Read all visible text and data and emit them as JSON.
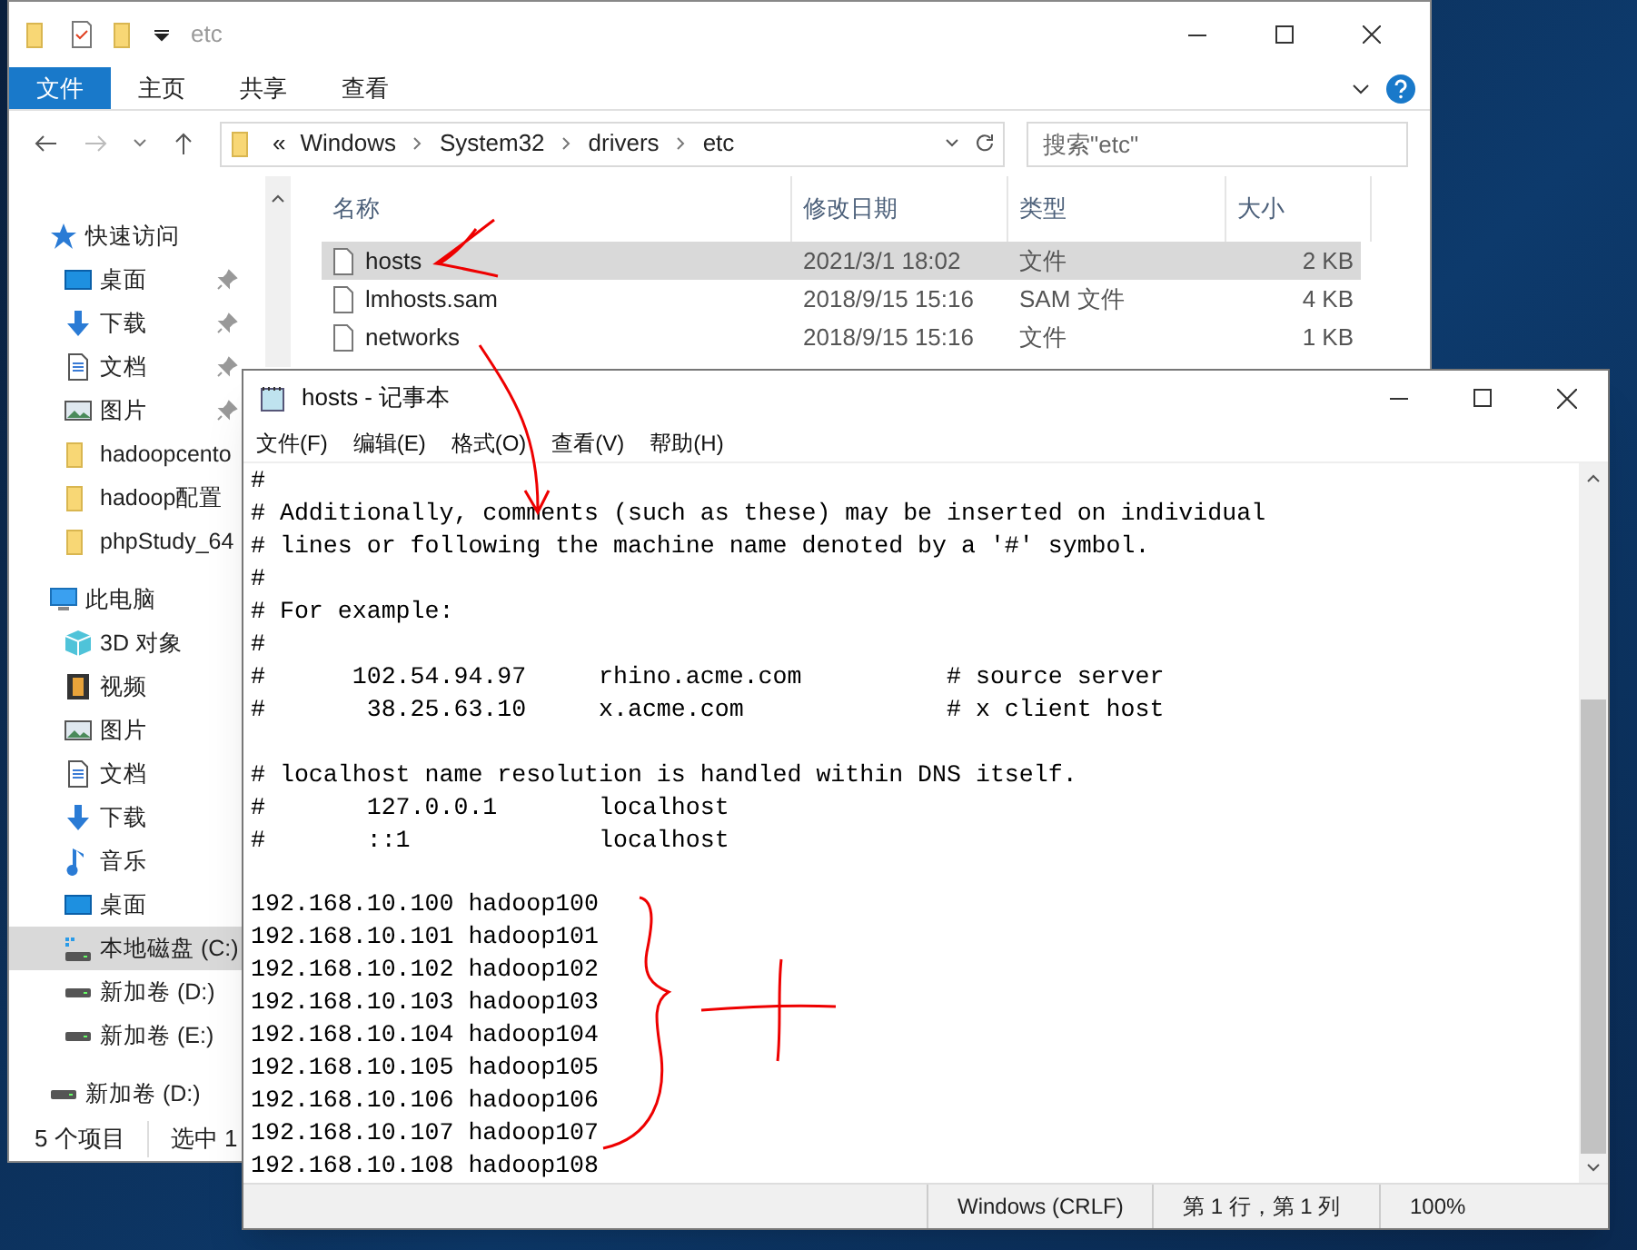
{
  "explorer": {
    "title": "etc",
    "ribbon_tabs": [
      {
        "label": "文件",
        "selected": true
      },
      {
        "label": "主页",
        "selected": false
      },
      {
        "label": "共享",
        "selected": false
      },
      {
        "label": "查看",
        "selected": false
      }
    ],
    "breadcrumb": [
      "«",
      "Windows",
      "System32",
      "drivers",
      "etc"
    ],
    "search": {
      "placeholder": "搜索\"etc\""
    },
    "nav": [
      {
        "label": "快速访问",
        "kind": "star",
        "selected": false,
        "children": [
          {
            "label": "桌面",
            "kind": "desktop",
            "pinned": true,
            "selected": false
          },
          {
            "label": "下载",
            "kind": "download",
            "pinned": true,
            "selected": false
          },
          {
            "label": "文档",
            "kind": "document",
            "pinned": true,
            "selected": false
          },
          {
            "label": "图片",
            "kind": "picture",
            "pinned": true,
            "selected": false
          },
          {
            "label": "hadoopcento",
            "kind": "folder",
            "pinned": false,
            "selected": false
          },
          {
            "label": "hadoop配置",
            "kind": "folder",
            "pinned": false,
            "selected": false
          },
          {
            "label": "phpStudy_64",
            "kind": "folder",
            "pinned": false,
            "selected": false
          }
        ]
      },
      {
        "label": "此电脑",
        "kind": "pc",
        "selected": false,
        "children": [
          {
            "label": "3D 对象",
            "kind": "cube",
            "selected": false
          },
          {
            "label": "视频",
            "kind": "video",
            "selected": false
          },
          {
            "label": "图片",
            "kind": "picture",
            "selected": false
          },
          {
            "label": "文档",
            "kind": "document",
            "selected": false
          },
          {
            "label": "下载",
            "kind": "download",
            "selected": false
          },
          {
            "label": "音乐",
            "kind": "music",
            "selected": false
          },
          {
            "label": "桌面",
            "kind": "desktop",
            "selected": false
          },
          {
            "label": "本地磁盘 (C:)",
            "kind": "system-drive",
            "selected": true
          },
          {
            "label": "新加卷 (D:)",
            "kind": "drive",
            "selected": false
          },
          {
            "label": "新加卷 (E:)",
            "kind": "drive",
            "selected": false
          }
        ]
      },
      {
        "label": "新加卷 (D:)",
        "kind": "drive",
        "selected": false
      }
    ],
    "columns": [
      "名称",
      "修改日期",
      "类型",
      "大小"
    ],
    "files": [
      {
        "name": "hosts",
        "modified": "2021/3/1 18:02",
        "type": "文件",
        "size": "2 KB",
        "selected": true
      },
      {
        "name": "lmhosts.sam",
        "modified": "2018/9/15 15:16",
        "type": "SAM 文件",
        "size": "4 KB",
        "selected": false
      },
      {
        "name": "networks",
        "modified": "2018/9/15 15:16",
        "type": "文件",
        "size": "1 KB",
        "selected": false
      }
    ],
    "status": [
      "5 个项目",
      "选中 1"
    ]
  },
  "notepad": {
    "title": "hosts - 记事本",
    "menu": [
      "文件(F)",
      "编辑(E)",
      "格式(O)",
      "查看(V)",
      "帮助(H)"
    ],
    "text": "#\n# Additionally, comments (such as these) may be inserted on individual\n# lines or following the machine name denoted by a '#' symbol.\n#\n# For example:\n#\n#      102.54.94.97     rhino.acme.com          # source server\n#       38.25.63.10     x.acme.com              # x client host\n\n# localhost name resolution is handled within DNS itself.\n#\t127.0.0.1       localhost\n#\t::1             localhost\n\n192.168.10.100 hadoop100\n192.168.10.101 hadoop101\n192.168.10.102 hadoop102\n192.168.10.103 hadoop103\n192.168.10.104 hadoop104\n192.168.10.105 hadoop105\n192.168.10.106 hadoop106\n192.168.10.107 hadoop107\n192.168.10.108 hadoop108",
    "status": [
      "Windows (CRLF)",
      "第 1 行，第 1 列",
      "100%"
    ]
  }
}
